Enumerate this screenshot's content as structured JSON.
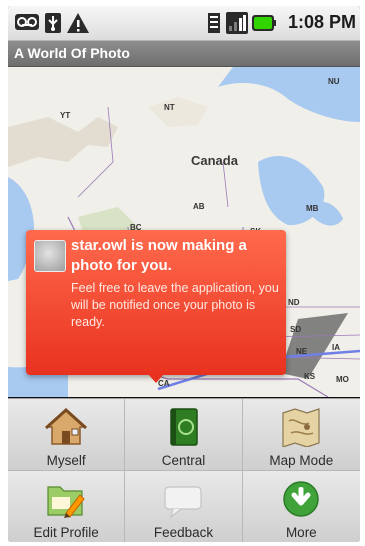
{
  "status_bar": {
    "time": "1:08 PM",
    "icons": [
      "voicemail-icon",
      "usb-icon",
      "warning-icon",
      "sd-card-icon",
      "signal-icon",
      "battery-icon"
    ]
  },
  "app": {
    "title": "A World Of Photo"
  },
  "map": {
    "country_label": "Canada",
    "region_labels": [
      "YT",
      "NT",
      "NU",
      "BC",
      "AB",
      "SK",
      "MB",
      "ND",
      "SD",
      "NE",
      "IA",
      "KS",
      "MO",
      "CA"
    ]
  },
  "notification": {
    "title": "star.owl is now making a photo for you.",
    "body": "Feel free to leave the application, you will be notified once your photo is ready."
  },
  "menu": {
    "items": [
      {
        "label": "Myself",
        "icon": "home-icon"
      },
      {
        "label": "Central",
        "icon": "central-icon"
      },
      {
        "label": "Map Mode",
        "icon": "map-icon"
      },
      {
        "label": "Edit Profile",
        "icon": "edit-profile-icon"
      },
      {
        "label": "Feedback",
        "icon": "feedback-icon"
      },
      {
        "label": "More",
        "icon": "more-icon"
      }
    ]
  },
  "colors": {
    "notification": "#e8321f",
    "water": "#9fc3ef",
    "land": "#f1efe9",
    "battery": "#32d400"
  }
}
